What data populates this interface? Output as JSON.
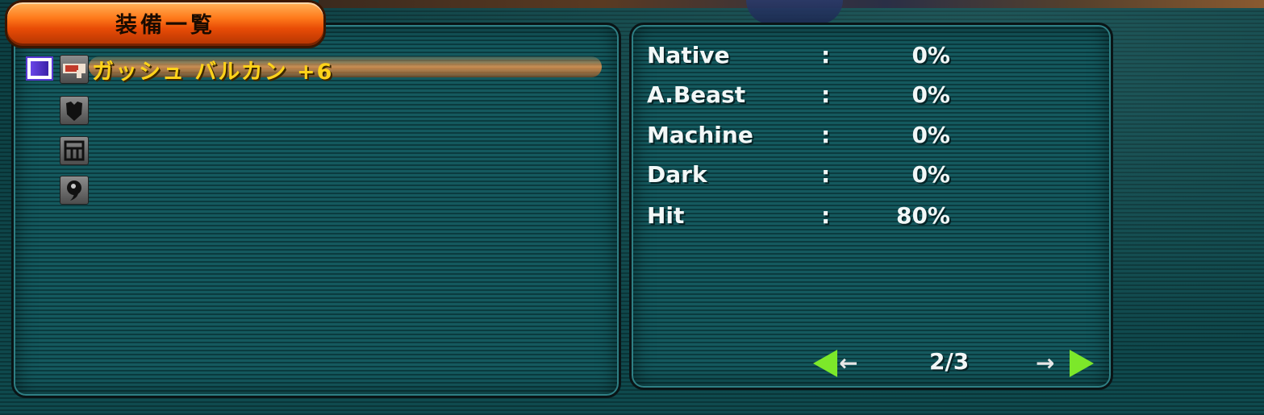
{
  "window": {
    "title": "装備一覧"
  },
  "equipment": {
    "items": [
      {
        "icon": "weapon-icon",
        "name": "ガッシュ バルカン +6",
        "selected": true
      },
      {
        "icon": "armor-icon",
        "name": ""
      },
      {
        "icon": "shield-icon",
        "name": ""
      },
      {
        "icon": "unit-icon",
        "name": ""
      }
    ]
  },
  "stats": [
    {
      "label": "Native",
      "sep": ":",
      "value": "0%"
    },
    {
      "label": "A.Beast",
      "sep": ":",
      "value": "0%"
    },
    {
      "label": "Machine",
      "sep": ":",
      "value": "0%"
    },
    {
      "label": "Dark",
      "sep": ":",
      "value": "0%"
    },
    {
      "label": "Hit",
      "sep": ":",
      "value": "80%"
    }
  ],
  "pager": {
    "text": "2/3",
    "prev_icon": "arrow-left-icon",
    "next_icon": "arrow-right-icon"
  },
  "colors": {
    "title_tab": "#ff7b1c",
    "item_name": "#ffd21a",
    "highlight": "#e89650",
    "arrow_green": "#7ce82a",
    "panel": "#14595e"
  }
}
